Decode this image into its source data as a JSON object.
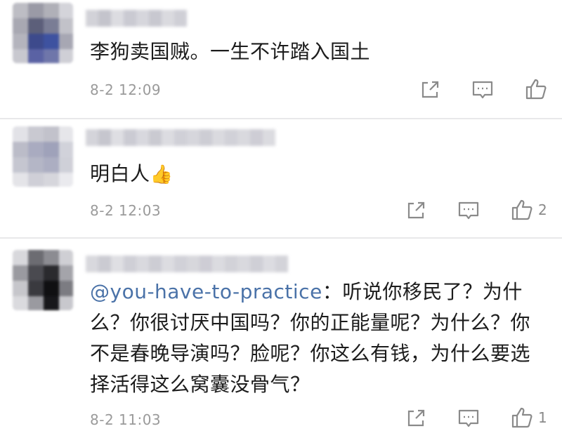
{
  "comments": [
    {
      "text": "李狗卖国贼。一生不许踏入国土",
      "time": "8-2 12:09",
      "likes": ""
    },
    {
      "text": "明白人",
      "emoji": "👍",
      "time": "8-2 12:03",
      "likes": "2"
    },
    {
      "mention": "@you-have-to-practice",
      "text_lines": [
        "：听说你移民了？为什",
        "么？你很讨厌中国吗？你的正能量呢？为什么？你",
        "不是春晚导演吗？脸呢？你这么有钱，为什么要选",
        "择活得这么窝囊没骨气？"
      ],
      "time": "8-2 11:03",
      "likes": "1"
    }
  ],
  "icons": {
    "share": "share-icon",
    "reply": "comment-icon",
    "like": "thumbs-up-icon"
  },
  "colors": {
    "mention": "#4a72a8",
    "meta": "#9a9a9a",
    "icon": "#8a8a8a",
    "divider": "#e8e8ea"
  }
}
